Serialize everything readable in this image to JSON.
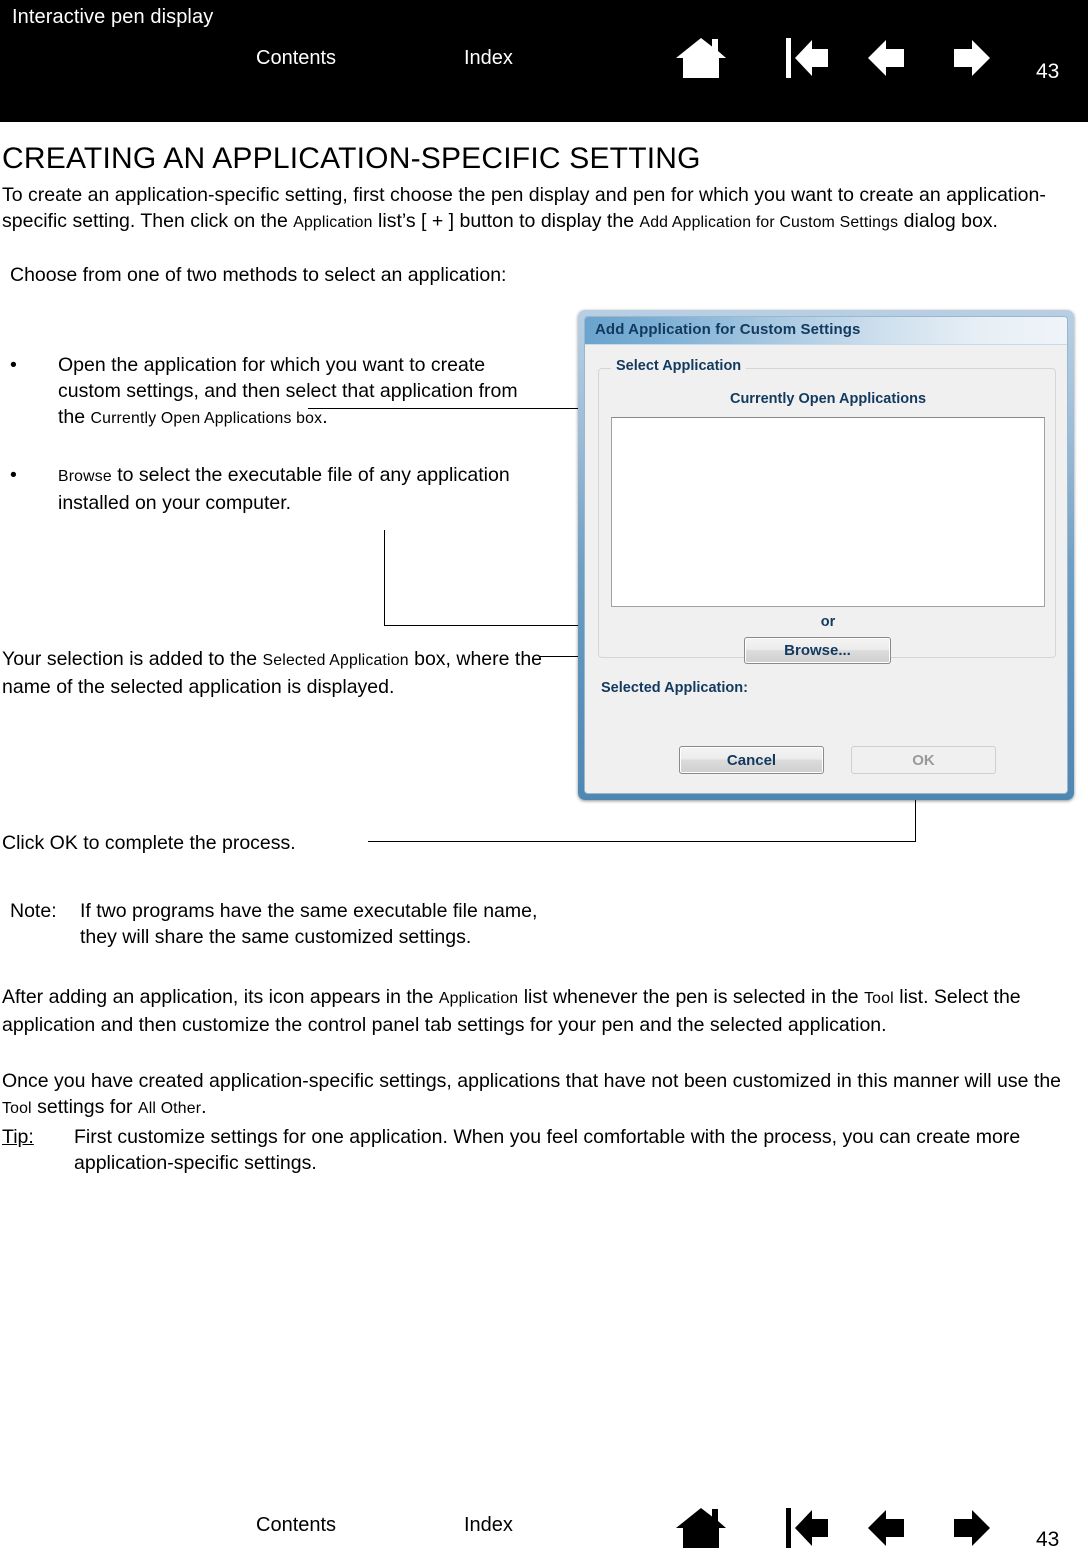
{
  "header": {
    "title": "Interactive pen display",
    "contents_label": "Contents",
    "index_label": "Index",
    "page_number": "43",
    "icons": [
      {
        "name": "home-icon",
        "label": "Home"
      },
      {
        "name": "first-page-icon",
        "label": "Go to first page"
      },
      {
        "name": "previous-page-icon",
        "label": "Previous page"
      },
      {
        "name": "next-page-icon",
        "label": "Next page"
      }
    ]
  },
  "footer": {
    "contents_label": "Contents",
    "index_label": "Index",
    "page_number": "43"
  },
  "content": {
    "page_title": "CREATING AN APPLICATION-SPECIFIC SETTING",
    "intro_paragraph_part1": "To create an application-specific setting, first choose the pen display and pen for which you want to create an application-specific setting.  Then click on the ",
    "intro_application_sc": "Application",
    "intro_paragraph_part2": " list’s [ + ] button to display the ",
    "intro_add_sc": "Add Application for Custom Settings",
    "intro_paragraph_part3": " dialog box.",
    "choose_methods": "Choose from one of two methods to select an application:",
    "bullet_marker": "•",
    "bullet_1_part1": "Open the application for which you want to create custom settings, and then select that application from the ",
    "bullet_1_sc": "Currently Open Applications box",
    "bullet_1_part2": ".",
    "bullet_2_sc": "Browse",
    "bullet_2_part1": " to select the executable file of any application installed on your computer.",
    "selection_part1": "Your selection is added to the ",
    "selection_sc": "Selected Application",
    "selection_part2": " box, where the name of the selected application is displayed.",
    "click_ok": "Click OK to complete the process.",
    "note_label": "Note:",
    "note_body": "If two programs have the same executable file name, they will share the same customized settings.",
    "after_part1": "After adding an application, its icon appears in the ",
    "after_sc1": "Application",
    "after_part2": " list whenever the pen is selected in the ",
    "after_sc2": "Tool",
    "after_part3": " list.  Select the application and then customize the control panel tab settings for your pen and the selected application.",
    "once_part1": "Once you have created application-specific settings, applications that have not been customized in this manner will use the ",
    "once_sc1": "Tool",
    "once_part2": " settings for ",
    "once_sc2": "All Other",
    "once_part3": ".",
    "tip_label": "Tip:",
    "tip_body": "First customize settings for one application.  When you feel comfortable with the process, you can create more application-specific settings."
  },
  "dialog": {
    "title": "Add Application for Custom Settings",
    "group_legend": "Select Application",
    "list_caption": "Currently Open Applications",
    "list_items": [],
    "or_label": "or",
    "browse_label": "Browse...",
    "selected_application_label": "Selected Application:",
    "selected_application_value": "",
    "cancel_label": "Cancel",
    "ok_label": "OK"
  },
  "colors": {
    "header_background": "#000000",
    "header_text": "#ffffff",
    "dialog_frame_blue": "#5c92bb",
    "dialog_titlebar_blue": "#6aa3cd",
    "dialog_text_blue": "#12395e",
    "dialog_face": "#f0f0f0",
    "page_background": "#ffffff"
  }
}
